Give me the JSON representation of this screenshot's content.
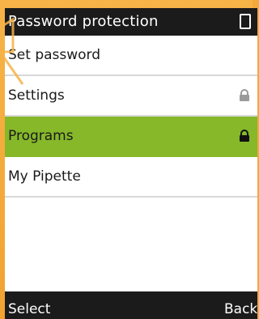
{
  "header": {
    "title": "Password protection",
    "status_icon": "battery-icon"
  },
  "menu": {
    "items": [
      {
        "label": "Set password",
        "icon": "",
        "selected": false
      },
      {
        "label": "Settings",
        "icon": "lock-icon",
        "selected": false
      },
      {
        "label": "Programs",
        "icon": "lock-icon",
        "selected": true
      },
      {
        "label": "My Pipette",
        "icon": "",
        "selected": false
      }
    ]
  },
  "softkeys": {
    "left": "Select",
    "right": "Back"
  },
  "colors": {
    "bezel": "#f4a93a",
    "bars": "#1b1b1b",
    "selected": "#86b82a",
    "divider": "#d8d8d8"
  }
}
